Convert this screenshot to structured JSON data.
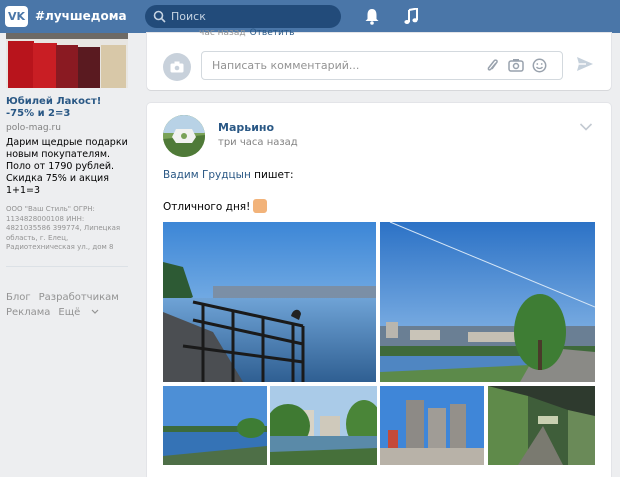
{
  "header": {
    "logo_text": "VK",
    "hashtag": "#лучшедома",
    "search_placeholder": "Поиск",
    "accent": "#4a76a8"
  },
  "ad": {
    "title": "Юбилей Лакост! -75% и 2=3",
    "domain": "polo-mag.ru",
    "text": "Дарим щедрые подарки новым покупателям. Поло от 1790 рублей. Скидка 75% и акция 1+1=3",
    "legal": "ООО \"Ваш Стиль\" ОГРН: 1134828000108 ИНН: 4821035586 399774, Липецкая область, г. Елец, Радиотехническая ул., дом 8"
  },
  "footer": {
    "links": [
      "Блог",
      "Разработчикам",
      "Реклама",
      "Ещё"
    ]
  },
  "composer": {
    "reply_time": "час назад",
    "reply_link": "Ответить",
    "placeholder": "Написать комментарий..."
  },
  "post": {
    "author": "Марьино",
    "time": "три часа назад",
    "quoted_user": "Вадим Грудцын",
    "quoted_suffix": " пишет:",
    "text": "Отличного дня!"
  },
  "icons": [
    "vk-logo",
    "search-icon",
    "bell-icon",
    "music-icon",
    "camera-icon",
    "clip-icon",
    "photo-icon",
    "smile-icon",
    "send-icon",
    "chevron-down-icon",
    "thumbs-up-emoji"
  ]
}
